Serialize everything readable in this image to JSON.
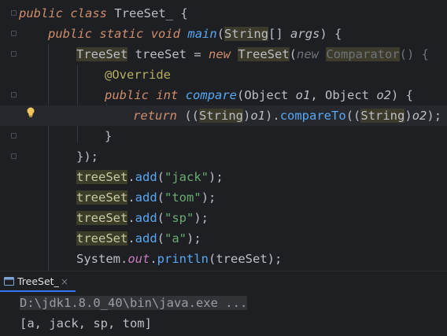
{
  "editor": {
    "line1": {
      "kw1": "public",
      "kw2": "class",
      "cls": "TreeSet_",
      "brace": " {"
    },
    "line2": {
      "kw1": "public",
      "kw2": "static",
      "kw3": "void",
      "fn": "main",
      "p1": "(",
      "type": "String",
      "p2": "[] ",
      "param": "args",
      "p3": ") {"
    },
    "line3": {
      "type1": "TreeSet",
      "var": "treeSet",
      "eq": " = ",
      "kwnew": "new",
      "type2": "TreeSet",
      "p1": "(",
      "kwnew2": "new ",
      "cmp": "Comparator",
      "p2": "() {"
    },
    "line4": {
      "ann": "@Override"
    },
    "line5": {
      "kw1": "public",
      "kw2": "int",
      "fn": "compare",
      "p1": "(Object ",
      "o1": "o1",
      ",": ", Object ",
      "o2": "o2",
      "p2": ") {"
    },
    "line6": {
      "kw": "return",
      "p1": " ((",
      "t1": "String",
      ")": ")",
      "o1": "o1",
      "p2": ").",
      "m": "compareTo",
      "p3": "((",
      "t2": "String",
      ")2": ")",
      "o2": "o2",
      "p4": ");"
    },
    "line7": {
      "brace": "}"
    },
    "line8": {
      "close": "});"
    },
    "adds": [
      {
        "var": "treeSet",
        "dot": ".",
        "m": "add",
        "arg": "\"jack\"",
        "end": ");"
      },
      {
        "var": "treeSet",
        "dot": ".",
        "m": "add",
        "arg": "\"tom\"",
        "end": ");"
      },
      {
        "var": "treeSet",
        "dot": ".",
        "m": "add",
        "arg": "\"sp\"",
        "end": ");"
      },
      {
        "var": "treeSet",
        "dot": ".",
        "m": "add",
        "arg": "\"a\"",
        "end": ");"
      }
    ],
    "println": {
      "cls": "System.",
      "field": "out",
      "dot": ".",
      "m": "println",
      "args": "(treeSet);"
    }
  },
  "run_panel": {
    "tab_label": "TreeSet_",
    "close_glyph": "×",
    "console_lines": [
      "D:\\jdk1.8.0_40\\bin\\java.exe ...",
      "[a, jack, sp, tom]"
    ]
  },
  "colors": {
    "background": "#1e1f22",
    "keyword": "#cf8e6d",
    "method": "#56a8f5",
    "string": "#6aab73",
    "annotation": "#b3ae60",
    "accent": "#3574f0"
  }
}
